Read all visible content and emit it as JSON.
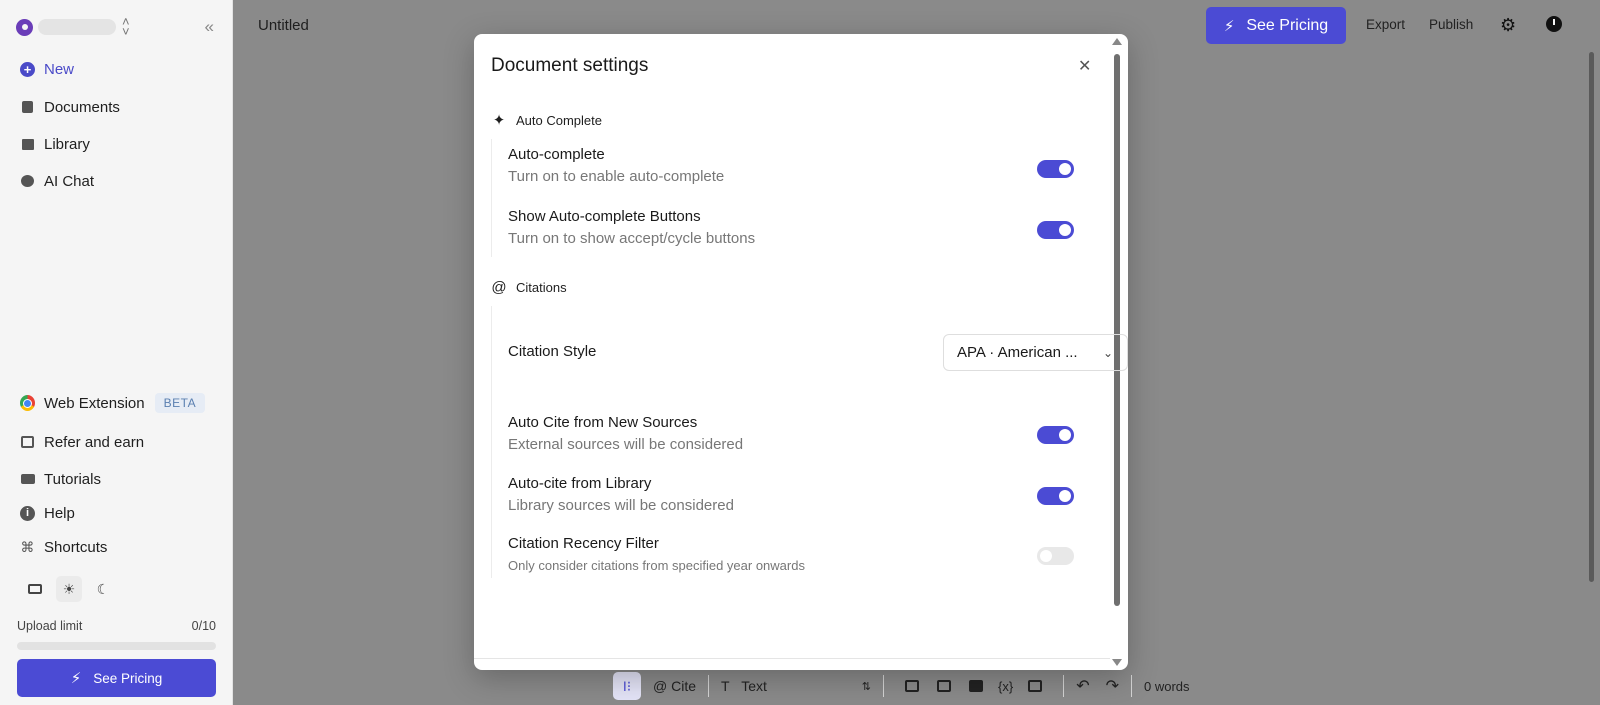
{
  "sidebar": {
    "nav": [
      {
        "label": "New",
        "icon": "plus-circle-icon"
      },
      {
        "label": "Documents",
        "icon": "documents-icon"
      },
      {
        "label": "Library",
        "icon": "library-icon"
      },
      {
        "label": "AI Chat",
        "icon": "chat-icon"
      }
    ],
    "bottom_nav": [
      {
        "label": "Web Extension",
        "badge": "BETA",
        "icon": "chrome-icon"
      },
      {
        "label": "Refer and earn",
        "icon": "gift-icon"
      },
      {
        "label": "Tutorials",
        "icon": "video-icon"
      },
      {
        "label": "Help",
        "icon": "info-icon",
        "glyph": "i"
      },
      {
        "label": "Shortcuts",
        "icon": "command-icon",
        "glyph": "⌘"
      }
    ],
    "theme_options": [
      "monitor-icon",
      "sun-icon",
      "moon-icon"
    ],
    "theme_glyphs": {
      "sun": "☀",
      "moon": "☾"
    },
    "collapse_glyph": "«",
    "upload_limit": {
      "label": "Upload limit",
      "count": "0/10",
      "used_fraction": 0.0
    },
    "pricing_button": "See Pricing"
  },
  "header": {
    "document_title": "Untitled",
    "pricing_button": "See Pricing",
    "export_label": "Export",
    "publish_label": "Publish",
    "gear_glyph": "⚙"
  },
  "toolbar": {
    "cite_label": "@ Cite",
    "text_style": "Text",
    "text_style_prefix": "T",
    "formula_label": "{x}",
    "undo_glyph": "↶",
    "redo_glyph": "↷",
    "word_count": "0 words"
  },
  "modal": {
    "title": "Document settings",
    "close_glyph": "✕",
    "sections": {
      "autocomplete": {
        "title": "Auto Complete",
        "icon_glyph": "✦",
        "rows": [
          {
            "label": "Auto-complete",
            "description": "Turn on to enable auto-complete",
            "enabled": true
          },
          {
            "label": "Show Auto-complete Buttons",
            "description": "Turn on to show accept/cycle buttons",
            "enabled": true
          }
        ]
      },
      "citations": {
        "title": "Citations",
        "icon_glyph": "@",
        "style_label": "Citation Style",
        "style_value": "APA · American ...",
        "rows": [
          {
            "label": "Auto Cite from New Sources",
            "description": "External sources will be considered",
            "enabled": true
          },
          {
            "label": "Auto-cite from Library",
            "description": "Library sources will be considered",
            "enabled": true
          },
          {
            "label": "Citation Recency Filter",
            "description": "Only consider citations from specified year onwards",
            "enabled": false
          }
        ]
      }
    }
  },
  "colors": {
    "accent": "#4b4bd4",
    "overlay": "#8a8a8a",
    "toggle_off": "#e8e8e8"
  }
}
